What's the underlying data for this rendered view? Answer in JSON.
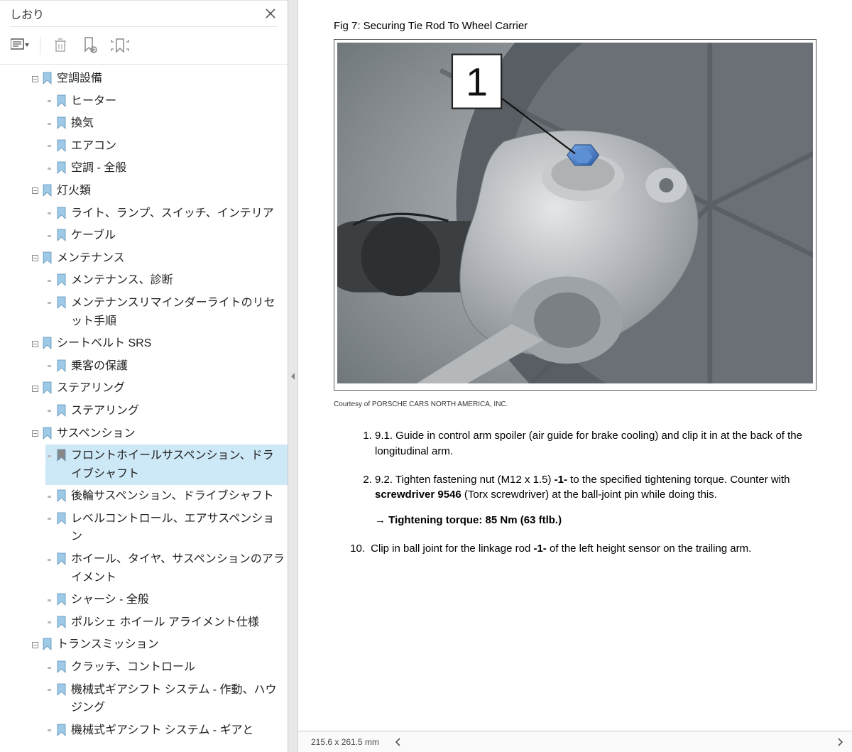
{
  "sidebar": {
    "title": "しおり",
    "tree": [
      {
        "label": "空調設備",
        "level": 0,
        "expanded": true,
        "children": [
          {
            "label": "ヒーター"
          },
          {
            "label": "換気"
          },
          {
            "label": "エアコン"
          },
          {
            "label": "空調 - 全般"
          }
        ]
      },
      {
        "label": "灯火類",
        "level": 0,
        "expanded": true,
        "children": [
          {
            "label": "ライト、ランプ、スイッチ、インテリア"
          },
          {
            "label": "ケーブル"
          }
        ]
      },
      {
        "label": "メンテナンス",
        "level": 0,
        "expanded": true,
        "children": [
          {
            "label": "メンテナンス、診断"
          },
          {
            "label": "メンテナンスリマインダーライトのリセット手順"
          }
        ]
      },
      {
        "label": "シートベルト   SRS",
        "level": 0,
        "expanded": true,
        "children": [
          {
            "label": "乗客の保護"
          }
        ]
      },
      {
        "label": "ステアリング",
        "level": 0,
        "expanded": true,
        "children": [
          {
            "label": "ステアリング"
          }
        ]
      },
      {
        "label": "サスペンション",
        "level": 0,
        "expanded": true,
        "children": [
          {
            "label": "フロントホイールサスペンション、ドライブシャフト",
            "selected": true
          },
          {
            "label": "後輪サスペンション、ドライブシャフト"
          },
          {
            "label": "レベルコントロール、エアサスペンション"
          },
          {
            "label": "ホイール、タイヤ、サスペンションのアライメント"
          },
          {
            "label": "シャーシ - 全般"
          },
          {
            "label": "ポルシェ ホイール アライメント仕様"
          }
        ]
      },
      {
        "label": "トランスミッション",
        "level": 0,
        "expanded": true,
        "children": [
          {
            "label": "クラッチ、コントロール"
          },
          {
            "label": "機械式ギアシフト システム - 作動、ハウジング"
          },
          {
            "label": "機械式ギアシフト システム - ギアと"
          }
        ]
      }
    ]
  },
  "document": {
    "fig_title": "Fig 7: Securing Tie Rod To Wheel Carrier",
    "callout_label": "1",
    "courtesy": "Courtesy of PORSCHE CARS NORTH AMERICA, INC.",
    "step_9_1_num": "1.",
    "step_9_1_pre": "9.1. Guide in control arm spoiler (air guide for brake cooling) and clip it in at the back of the longitudinal arm.",
    "step_9_2_num": "2.",
    "step_9_2_a": "9.2. Tighten fastening nut (M12 x 1.5) ",
    "step_9_2_b": "-1-",
    "step_9_2_c": "  to the specified tightening torque. Counter with ",
    "step_9_2_d": "screwdriver 9546",
    "step_9_2_e": "  (Torx screwdriver) at the ball-joint pin while doing this.",
    "torque_arrow": "→ ",
    "torque_text": "Tightening torque: 85 Nm (63 ftlb.)",
    "step_10_num": "10.",
    "step_10_a": " Clip in ball joint for the linkage rod ",
    "step_10_b": "-1-",
    "step_10_c": "  of the left height sensor on the trailing arm."
  },
  "status": {
    "dimensions": "215.6 x 261.5 mm"
  }
}
